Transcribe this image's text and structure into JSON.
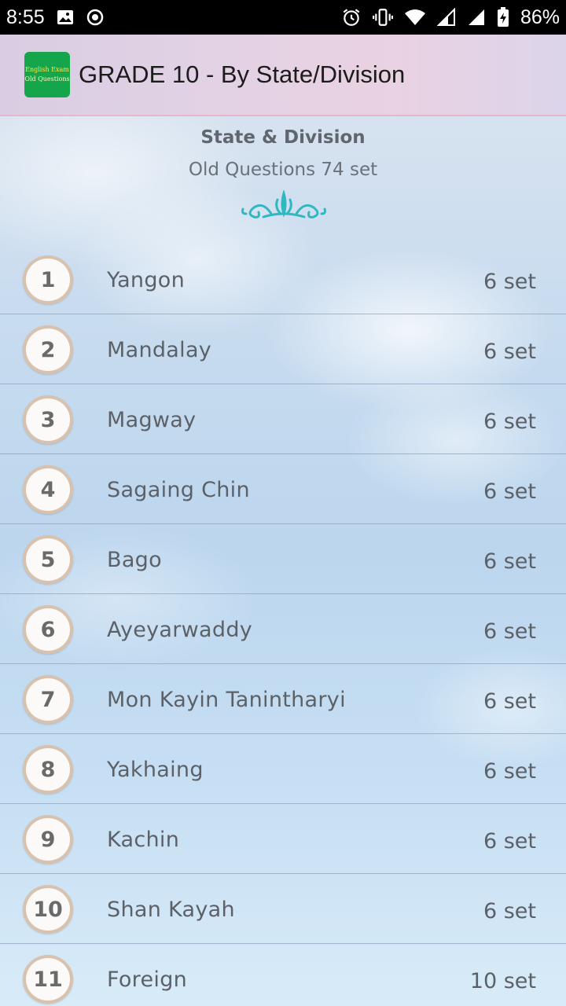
{
  "status_bar": {
    "time": "8:55",
    "battery": "86%",
    "icons_left": [
      "image-icon",
      "record-icon"
    ],
    "icons_right": [
      "alarm-icon",
      "vibrate-icon",
      "wifi-icon",
      "signal-icon",
      "signal-icon",
      "battery-charging-icon"
    ]
  },
  "app_bar": {
    "logo_line1": "English Exam",
    "logo_line2": "Old Questions",
    "title": "GRADE 10 - By State/Division"
  },
  "header": {
    "title": "State & Division",
    "subtitle": "Old Questions 74 set"
  },
  "items": [
    {
      "num": "1",
      "name": "Yangon",
      "count": "6 set"
    },
    {
      "num": "2",
      "name": "Mandalay",
      "count": "6 set"
    },
    {
      "num": "3",
      "name": "Magway",
      "count": "6 set"
    },
    {
      "num": "4",
      "name": "Sagaing Chin",
      "count": "6 set"
    },
    {
      "num": "5",
      "name": "Bago",
      "count": "6 set"
    },
    {
      "num": "6",
      "name": "Ayeyarwaddy",
      "count": "6 set"
    },
    {
      "num": "7",
      "name": "Mon Kayin Tanintharyi",
      "count": "6 set"
    },
    {
      "num": "8",
      "name": "Yakhaing",
      "count": "6 set"
    },
    {
      "num": "9",
      "name": "Kachin",
      "count": "6 set"
    },
    {
      "num": "10",
      "name": "Shan Kayah",
      "count": "6 set"
    },
    {
      "num": "11",
      "name": "Foreign",
      "count": "10 set"
    }
  ],
  "colors": {
    "accent_ornament": "#2fb8c0",
    "circle_border": "#d8c2ae",
    "text": "#5c6168"
  }
}
